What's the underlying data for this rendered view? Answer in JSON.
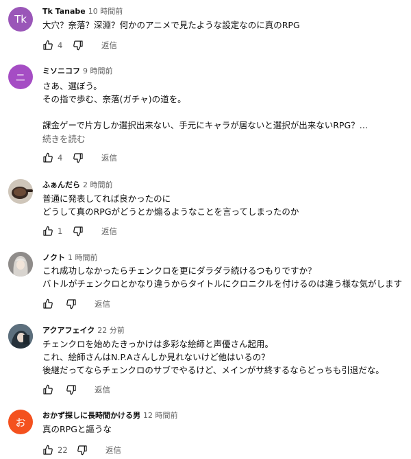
{
  "comments": [
    {
      "avatar_text": "Tk",
      "avatar_color": "#9a56b8",
      "author": "Tk Tanabe",
      "time": "10 時間前",
      "lines": [
        "大穴？奈落？深淵？何かのアニメで見たような設定なのに真のRPG"
      ],
      "likes": "4",
      "reply": "返信"
    },
    {
      "avatar_text": "ニ",
      "avatar_color": "#a54dc4",
      "author": "ミソニコフ",
      "time": "9 時間前",
      "lines": [
        "さあ、選ぼう。",
        "その指で歩む、奈落(ガチャ)の道を。",
        "",
        "課金ゲーで片方しか選択出来ない、手元にキャラが居ないと選択が出来ないRPG？…"
      ],
      "more": "続きを読む",
      "likes": "4",
      "reply": "返信"
    },
    {
      "avatar_text": "",
      "avatar_color": "#6b5a4e",
      "author": "ふぁんだら",
      "time": "2 時間前",
      "lines": [
        "普通に発表してれば良かったのに",
        "どうして真のRPGがどうとか煽るようなことを言ってしまったのか"
      ],
      "likes": "1",
      "reply": "返信"
    },
    {
      "avatar_text": "",
      "avatar_color": "#b9b4b0",
      "author": "ノクト",
      "time": "1 時間前",
      "lines": [
        "これ成功しなかったらチェンクロを更にダラダラ続けるつもりですか？",
        "バトルがチェンクロとかなり違うからタイトルにクロニクルを付けるのは違う様な気がします"
      ],
      "likes": "",
      "reply": "返信"
    },
    {
      "avatar_text": "",
      "avatar_color": "#3e4f5c",
      "author": "アクアフェイク",
      "time": "22 分前",
      "lines": [
        "チェンクロを始めたきっかけは多彩な絵師と声優さん起用。",
        "これ、絵師さんはN.P.Aさんしか見れないけど他はいるの？",
        "後継だってならチェンクロのサブでやるけど、メインがサ終するならどっちも引退だな。"
      ],
      "likes": "",
      "reply": "返信"
    },
    {
      "avatar_text": "お",
      "avatar_color": "#f4511e",
      "author": "おかず探しに長時間かける男",
      "time": "12 時間前",
      "lines": [
        "真のRPGと謳うな"
      ],
      "likes": "22",
      "reply": "返信"
    }
  ]
}
